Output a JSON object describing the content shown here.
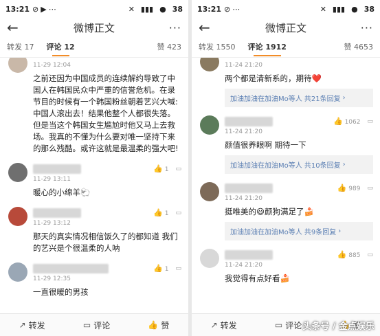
{
  "left": {
    "status": {
      "time": "13:21",
      "battery": "38"
    },
    "nav": {
      "title": "微博正文",
      "more": "···"
    },
    "tabs": {
      "repost": "转发 17",
      "comment": "评论 12",
      "likes": "赞 423"
    },
    "comments": [
      {
        "time": "11-29 12:04",
        "text": "之前还因为中国成员的连续解约导致了中国人在韩国民众中严重的信誉危机。在录节目的时候有一个韩国粉丝朝着艺兴大喊:中国人滚出去！结果他整个人都很失落。但是当这个韩国女生尴尬时他又马上去救场。我真的不懂为什么要对唯一坚持下来的那么残酷。或许这就是最温柔的强大吧!",
        "likes": "",
        "avatar_color": "#c9b8a8"
      },
      {
        "time": "11-29 13:11",
        "text": "暖心的小绵羊🐑",
        "likes": "1",
        "avatar_color": "#6f6f6f"
      },
      {
        "time": "11-29 13:12",
        "text": "那天的真实情况相信饭久了的都知道 我们的艺兴是个很温柔的人呐",
        "likes": "1",
        "avatar_color": "#b84a3a"
      },
      {
        "time": "11-29 12:35",
        "text": "一直很暖的男孩",
        "likes": "1",
        "avatar_color": "#9aa7b5"
      }
    ],
    "bottom": {
      "repost": "转发",
      "comment": "评论",
      "like": "赞"
    }
  },
  "right": {
    "status": {
      "time": "13:21",
      "battery": "38"
    },
    "nav": {
      "title": "微博正文",
      "more": "···"
    },
    "tabs": {
      "repost": "转发 1550",
      "comment": "评论 1912",
      "likes": "赞 4653"
    },
    "comments": [
      {
        "time": "11-24 21:20",
        "text": "两个都是清新系的，期待❤️",
        "likes": "",
        "reply": "加油加油在加油Mo等人 共21条回复",
        "avatar_color": "#8a7a60"
      },
      {
        "time": "11-24 21:20",
        "text": "颜值很养眼啊 期待一下",
        "likes": "1062",
        "reply": "加油加油在加油Mo等人 共10条回复",
        "avatar_color": "#5b7b5a"
      },
      {
        "time": "11-24 21:20",
        "text": "挺唯美的😃颜狗满足了🍰",
        "likes": "989",
        "reply": "加油加油在加油Mo等人 共9条回复",
        "avatar_color": "#7d6a58"
      },
      {
        "time": "11-24 21:20",
        "text": "我觉得有点好看🍰",
        "likes": "885",
        "reply": "",
        "avatar_color": "#d8d8d8"
      }
    ],
    "bottom": {
      "repost": "转发",
      "comment": "评论",
      "like": "赞"
    }
  },
  "watermark": "头条号 / 金点娱乐"
}
